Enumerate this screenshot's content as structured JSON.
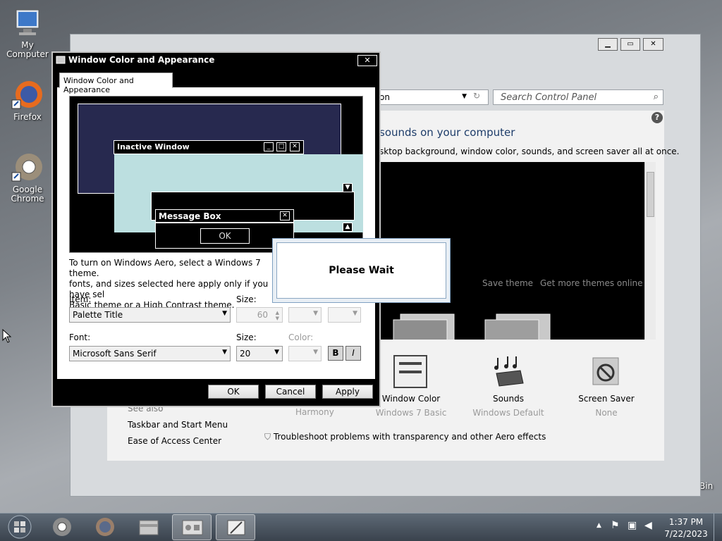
{
  "desktop": {
    "icons": [
      {
        "label": "My Computer"
      },
      {
        "label": "Firefox"
      },
      {
        "label": "Google Chrome"
      }
    ],
    "recycle_bin_partial": "Bin"
  },
  "control_panel": {
    "address_partial": "on",
    "search_placeholder": "Search Control Panel",
    "heading": "sounds on your computer",
    "subheading": "sktop background, window color, sounds, and screen saver all at once.",
    "gallery_links": [
      "Save theme",
      "Get more themes online"
    ],
    "items": [
      {
        "label": "Window Color",
        "value": "Windows 7 Basic"
      },
      {
        "label": "Sounds",
        "value": "Windows Default"
      },
      {
        "label": "Screen Saver",
        "value": "None"
      }
    ],
    "partial_value": "Harmony",
    "see_also": {
      "title": "See also",
      "links": [
        "Taskbar and Start Menu",
        "Ease of Access Center"
      ]
    },
    "troubleshoot": "Troubleshoot problems with transparency and other Aero effects"
  },
  "dialog": {
    "title": "Window Color and Appearance",
    "tab": "Window Color and Appearance",
    "preview": {
      "inactive_window": "Inactive Window",
      "message_box": "Message Box",
      "ok": "OK"
    },
    "text_lines": [
      "To turn on Windows Aero, select a Windows 7 theme.",
      "fonts, and sizes selected here apply only if you have sel",
      "Basic theme or a High Contrast theme."
    ],
    "item_label": "Item:",
    "item_value": "Palette Title",
    "size_label": "Size:",
    "item_size": "60",
    "font_label": "Font:",
    "font_value": "Microsoft Sans Serif",
    "font_size_label": "Size:",
    "font_size": "20",
    "color_label": "Color:",
    "bold": "B",
    "italic": "I",
    "buttons": {
      "ok": "OK",
      "cancel": "Cancel",
      "apply": "Apply"
    }
  },
  "wait": {
    "text": "Please Wait"
  },
  "taskbar": {
    "time": "1:37 PM",
    "date": "7/22/2023"
  }
}
